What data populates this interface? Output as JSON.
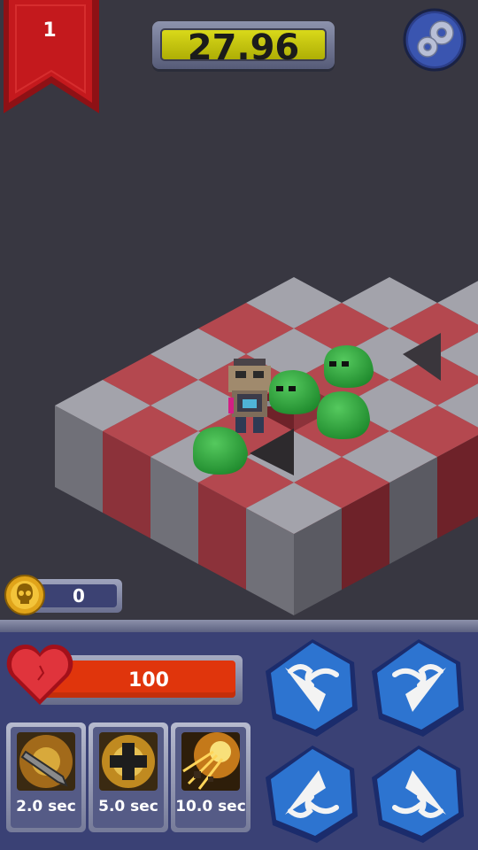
{
  "hud": {
    "level": "1",
    "timer": "27.96",
    "coins": "0"
  },
  "player": {
    "health": "100"
  },
  "skills": [
    {
      "name": "sword-slash",
      "cooldown": "2.0 sec"
    },
    {
      "name": "heal-cross",
      "cooldown": "5.0 sec"
    },
    {
      "name": "explosion",
      "cooldown": "10.0 sec"
    }
  ],
  "direction_buttons": [
    "up-left",
    "up-right",
    "down-left",
    "down-right"
  ],
  "colors": {
    "background": "#383741",
    "tile_gray": "#a3a3ab",
    "tile_red": "#b4484f",
    "slime": "#2f9e3c",
    "ribbon": "#c4191d",
    "timer_face": "#c9c90f",
    "health": "#e0350c",
    "button_blue": "#2d74d0",
    "panel": "#3a4175"
  }
}
